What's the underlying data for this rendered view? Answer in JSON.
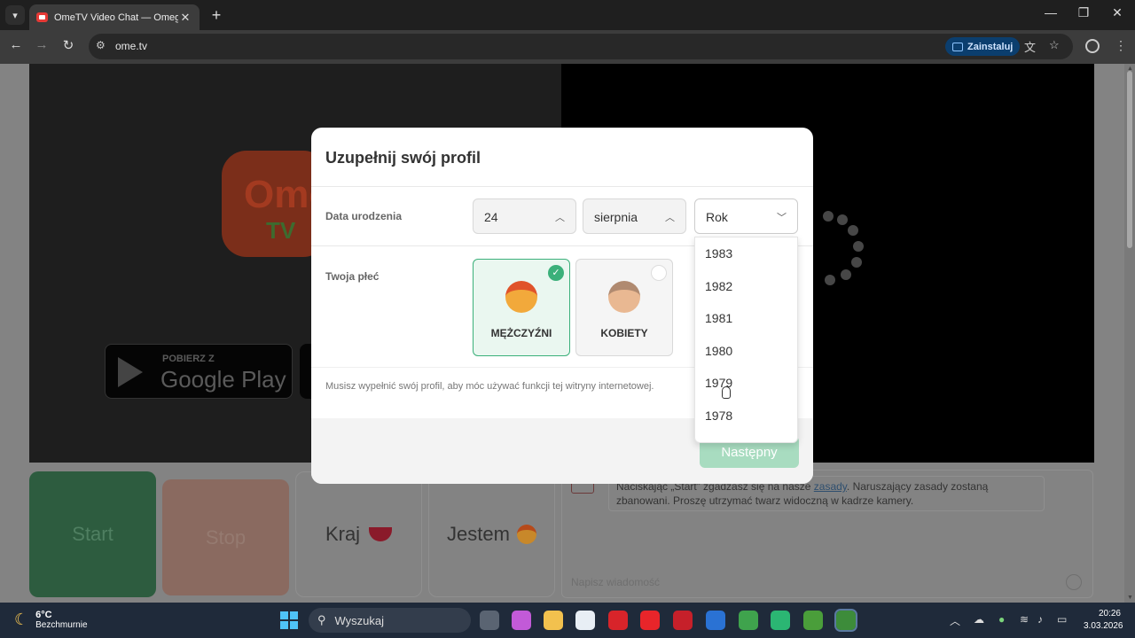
{
  "browser": {
    "tab_title": "OmeTV Video Chat — Omegle",
    "url": "ome.tv",
    "install_label": "Zainstaluj"
  },
  "site": {
    "logo_top": "Ome",
    "logo_bottom": "TV",
    "store_small": "POBIERZ Z",
    "store_big": "Google Play",
    "start": "Start",
    "stop": "Stop",
    "country": "Kraj",
    "iam": "Jestem",
    "chat_message_pre": "Naciskając „Start” zgadzasz się na nasze ",
    "chat_link": "zasady",
    "chat_message_post": ". Naruszający zasady zostaną zbanowani. Proszę utrzymać twarz widoczną w kadrze kamery.",
    "chat_placeholder": "Napisz wiadomość"
  },
  "modal": {
    "title": "Uzupełnij swój profil",
    "birth_label": "Data urodzenia",
    "day": "24",
    "month": "sierpnia",
    "year_placeholder": "Rok",
    "gender_label": "Twoja płeć",
    "gender_male": "MĘŻCZYŹNI",
    "gender_female": "KOBIETY",
    "selected_gender": "MĘŻCZYŹNI",
    "note": "Musisz wypełnić swój profil, aby móc używać funkcji tej witryny internetowej.",
    "next": "Następny",
    "year_options": [
      "1983",
      "1982",
      "1981",
      "1980",
      "1979",
      "1978"
    ]
  },
  "taskbar": {
    "temp": "6°C",
    "weather": "Bezchmurnie",
    "search": "Wyszukaj",
    "time": "20:26",
    "date": "3.03.2026"
  },
  "colors": {
    "accent_green": "#3bb07a",
    "next_button": "#a8dcc0"
  }
}
